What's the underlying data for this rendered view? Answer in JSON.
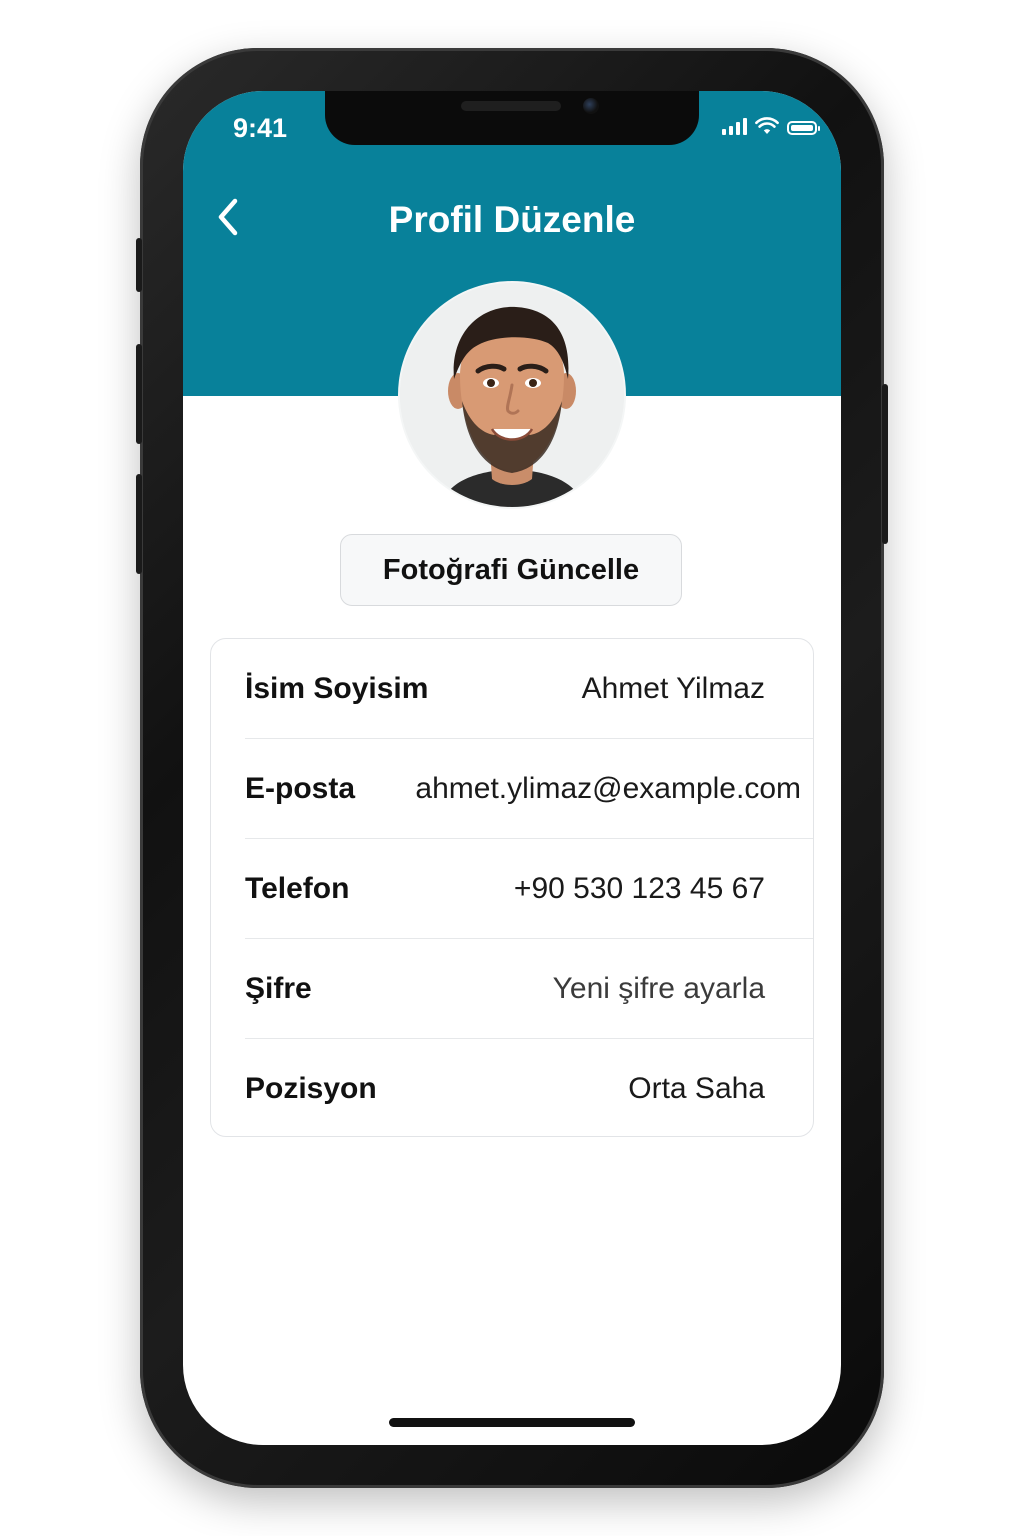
{
  "status_bar": {
    "time": "9:41",
    "icons": [
      "cellular-signal-icon",
      "wifi-icon",
      "battery-icon"
    ]
  },
  "header": {
    "title": "Profil Düzenle",
    "back_icon": "chevron-left-icon",
    "background_color": "#08819a"
  },
  "avatar": {
    "alt": "profile-photo"
  },
  "photo_button": {
    "label": "Fotoğrafi Güncelle"
  },
  "fields": [
    {
      "label": "İsim Soyisim",
      "value": "Ahmet Yilmaz"
    },
    {
      "label": "E-posta",
      "value": "ahmet.ylimaz@example.com"
    },
    {
      "label": "Telefon",
      "value": "+90 530 123 45 67"
    },
    {
      "label": "Şifre",
      "value": "Yeni şifre ayarla"
    },
    {
      "label": "Pozisyon",
      "value": "Orta Saha"
    }
  ]
}
